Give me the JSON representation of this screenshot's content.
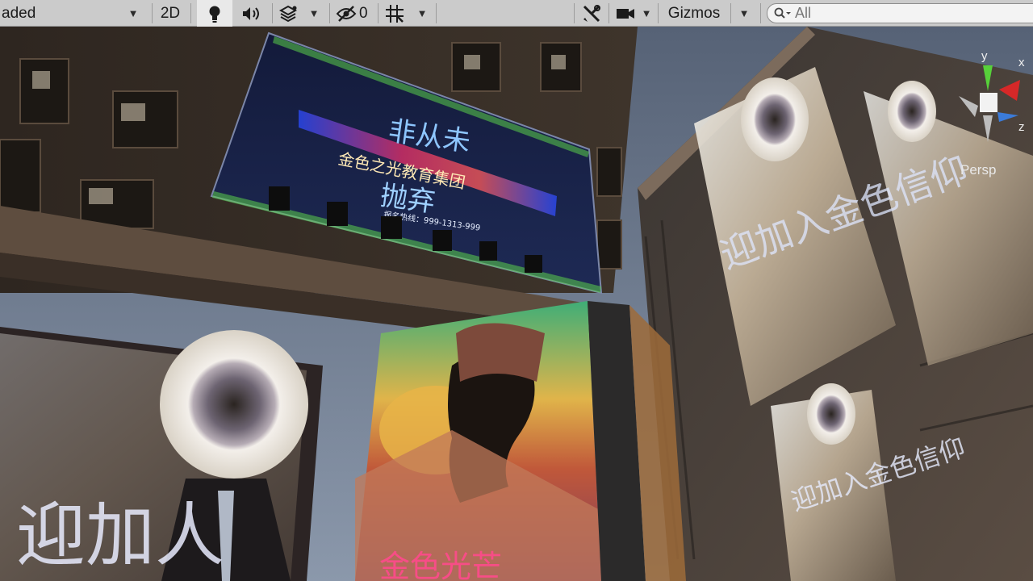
{
  "toolbar": {
    "shading_mode": "aded",
    "mode_2d": "2D",
    "hidden_count": "0",
    "gizmos_label": "Gizmos",
    "search_placeholder": "All"
  },
  "scene_view": {
    "projection_label": "Persp",
    "gizmo_axes": {
      "y": "y",
      "x": "x",
      "z": "z"
    },
    "billboard_top": {
      "line1": "非从未",
      "line2": "金色之光教育集团",
      "line3": "抛弃",
      "hotline": "报名热线：999-1313-999"
    },
    "poster_bottom_left": "迎加人",
    "poster_right_text": "迎加入金色信仰",
    "poster_right_small_text": "迎加入金色信仰",
    "cube_bottom_text": "金色光芒"
  },
  "colors": {
    "toolbar_bg": "#cbcbcb",
    "sky": "#4f5b6e",
    "neon_blue": "#2a4cff",
    "neon_red": "#e8306a",
    "gizmo_y": "#57d13a",
    "gizmo_x": "#d62828",
    "gizmo_z": "#3b7bd9"
  }
}
